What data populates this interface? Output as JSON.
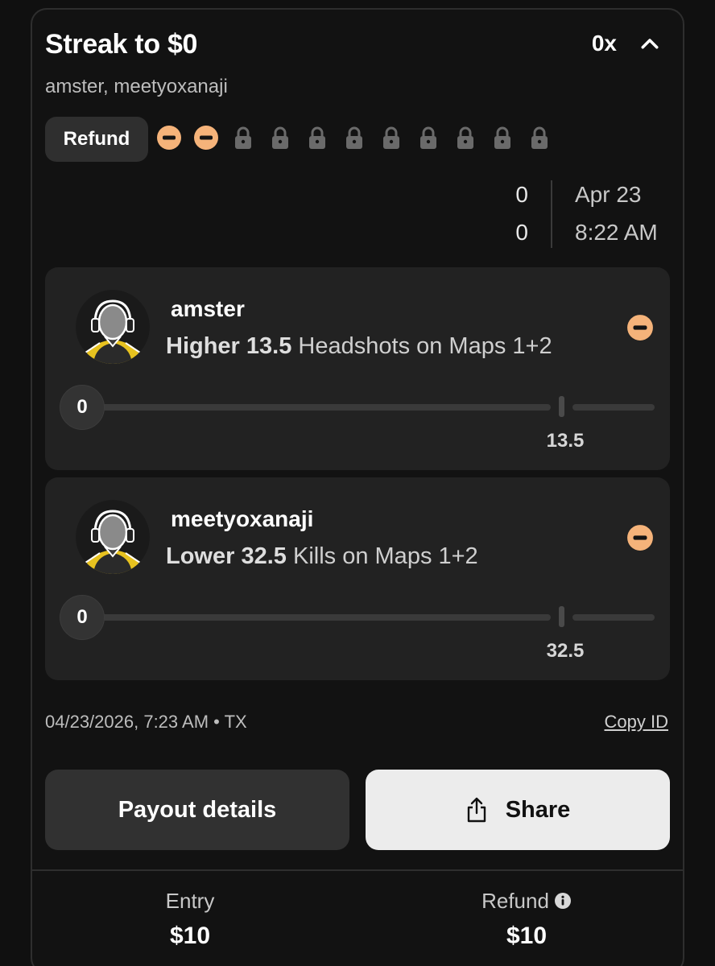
{
  "header": {
    "title": "Streak to $0",
    "multiplier": "0x",
    "collapse_icon": "chevron-up-icon",
    "subtitle": "amster, meetyoxanaji"
  },
  "status_row": {
    "refund_label": "Refund",
    "legs": [
      {
        "state": "refunded",
        "icon": "minus-circle-icon"
      },
      {
        "state": "refunded",
        "icon": "minus-circle-icon"
      },
      {
        "state": "locked",
        "icon": "lock-icon"
      },
      {
        "state": "locked",
        "icon": "lock-icon"
      },
      {
        "state": "locked",
        "icon": "lock-icon"
      },
      {
        "state": "locked",
        "icon": "lock-icon"
      },
      {
        "state": "locked",
        "icon": "lock-icon"
      },
      {
        "state": "locked",
        "icon": "lock-icon"
      },
      {
        "state": "locked",
        "icon": "lock-icon"
      },
      {
        "state": "locked",
        "icon": "lock-icon"
      },
      {
        "state": "locked",
        "icon": "lock-icon"
      }
    ]
  },
  "scoreboard": {
    "score_1": "0",
    "score_2": "0",
    "date": "Apr 23",
    "time": "8:22 AM"
  },
  "picks": [
    {
      "player": "amster",
      "direction": "Higher",
      "line": "13.5",
      "stat": "Headshots on Maps 1+2",
      "current": "0",
      "line_marker": "13.5",
      "progress": 0,
      "status_icon": "minus-circle-icon"
    },
    {
      "player": "meetyoxanaji",
      "direction": "Lower",
      "line": "32.5",
      "stat": "Kills on Maps 1+2",
      "current": "0",
      "line_marker": "32.5",
      "progress": 0,
      "status_icon": "minus-circle-icon"
    }
  ],
  "footer_meta": {
    "placed": "04/23/2026, 7:23 AM • TX",
    "copy_id": "Copy ID"
  },
  "actions": {
    "payout_label": "Payout details",
    "share_label": "Share",
    "share_icon": "share-icon"
  },
  "summary": {
    "entry_label": "Entry",
    "entry_value": "$10",
    "refund_label": "Refund",
    "refund_value": "$10",
    "info_icon": "info-icon"
  },
  "colors": {
    "refund_orange": "#F5B37A",
    "lock_gray": "#6a6a6a",
    "card_bg": "#121212",
    "pick_bg": "#222222",
    "avatar_accent": "#E7C21F"
  }
}
